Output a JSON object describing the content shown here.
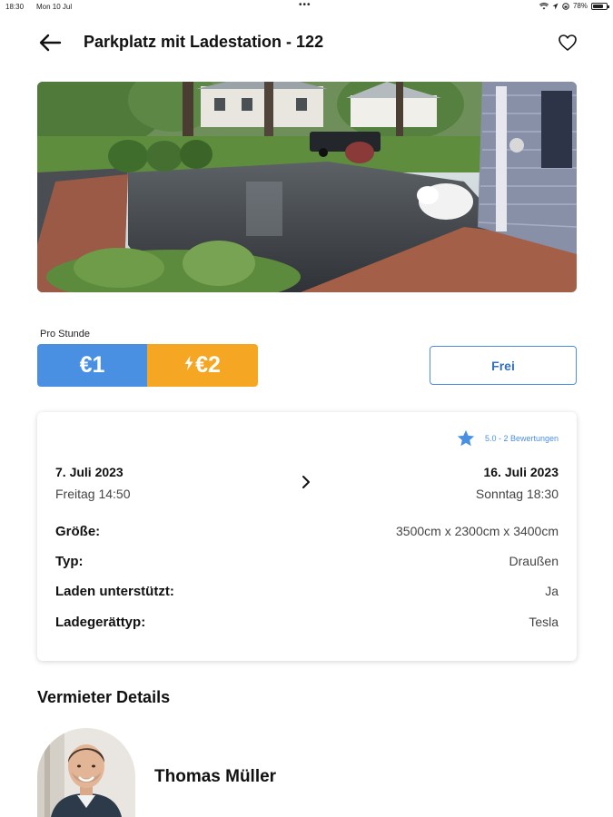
{
  "status_bar": {
    "time": "18:30",
    "date": "Mon 10 Jul",
    "dots": "•••",
    "battery": "78%",
    "battery_level": 0.78
  },
  "header": {
    "title": "Parkplatz mit Ladestation - 122",
    "back_icon": "arrow-left-icon",
    "favorite_icon": "heart-outline-icon"
  },
  "pricing": {
    "label": "Pro Stunde",
    "normal_price": "€1",
    "charging_price": "€2",
    "charging_icon": "bolt-icon",
    "availability": "Frei"
  },
  "details": {
    "rating_text": "5.0 - 2 Bewertungen",
    "start_date": "7. Juli 2023",
    "start_time": "Freitag 14:50",
    "end_date": "16. Juli 2023",
    "end_time": "Sonntag 18:30",
    "rows": [
      {
        "key": "Größe:",
        "value": "3500cm x 2300cm x 3400cm"
      },
      {
        "key": "Typ:",
        "value": "Draußen"
      },
      {
        "key": "Laden unterstützt:",
        "value": "Ja"
      },
      {
        "key": "Ladegerättyp:",
        "value": "Tesla"
      }
    ]
  },
  "landlord": {
    "section_title": "Vermieter Details",
    "name": "Thomas Müller"
  },
  "colors": {
    "accent_blue": "#4a90e2",
    "accent_orange": "#f5a623"
  }
}
